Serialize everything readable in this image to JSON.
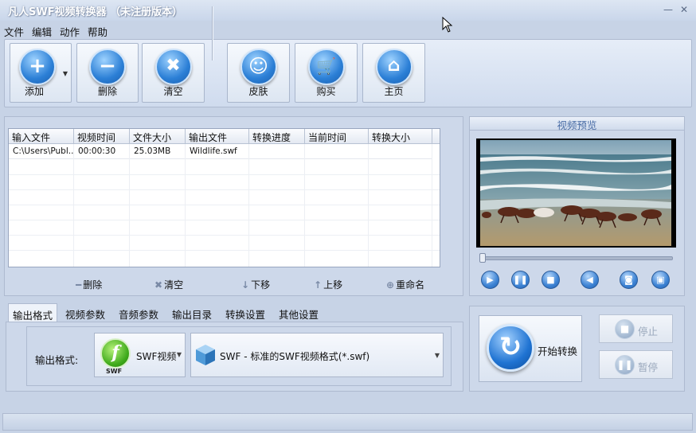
{
  "window": {
    "title": "凡人SWF视频转换器 （未注册版本）",
    "minimize_glyph": "—",
    "close_glyph": "✕"
  },
  "menu": [
    "文件",
    "编辑",
    "动作",
    "帮助"
  ],
  "toolbar": {
    "add": "添加",
    "delete": "删除",
    "clear": "清空",
    "skin": "皮肤",
    "buy": "购买",
    "home": "主页"
  },
  "table": {
    "columns": [
      "输入文件",
      "视频时间",
      "文件大小",
      "输出文件",
      "转换进度",
      "当前时间",
      "转换大小"
    ],
    "rows": [
      [
        "C:\\Users\\Publ...",
        "00:00:30",
        "25.03MB",
        "Wildlife.swf",
        "",
        "",
        ""
      ]
    ]
  },
  "list_actions": {
    "delete": "删除",
    "clear": "清空",
    "down": "下移",
    "up": "上移",
    "rename": "重命名"
  },
  "tabs": [
    "输出格式",
    "视频参数",
    "音频参数",
    "输出目录",
    "转换设置",
    "其他设置"
  ],
  "output": {
    "label": "输出格式:",
    "format_button": "SWF视频",
    "format_icon_text": "SWF",
    "format_desc": "SWF - 标准的SWF视频格式(*.swf)"
  },
  "preview": {
    "title": "视频预览",
    "seek_position": 0.0
  },
  "convert": {
    "start": "开始转换",
    "stop": "停止",
    "pause": "暂停"
  },
  "colors": {
    "accent_blue": "#2b7fd6",
    "panel": "#cdd8ea",
    "title_text": "#4a6da6",
    "disabled_text": "#9aa8bc"
  }
}
